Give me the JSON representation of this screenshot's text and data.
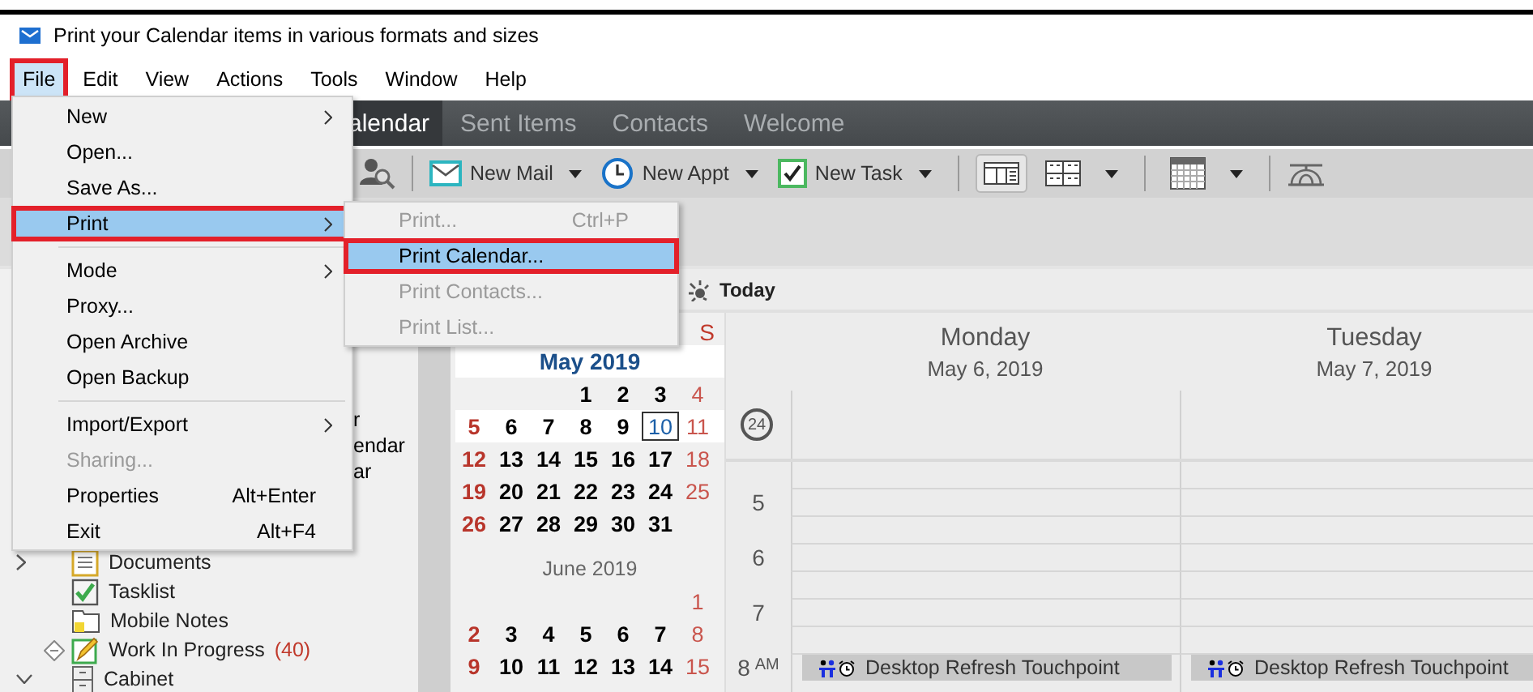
{
  "window": {
    "title": "Print your Calendar items in various formats and sizes"
  },
  "menu_bar": [
    {
      "label": "File",
      "selected": true,
      "callout": true
    },
    {
      "label": "Edit",
      "selected": false,
      "callout": false
    },
    {
      "label": "View",
      "selected": false,
      "callout": false
    },
    {
      "label": "Actions",
      "selected": false,
      "callout": false
    },
    {
      "label": "Tools",
      "selected": false,
      "callout": false
    },
    {
      "label": "Window",
      "selected": false,
      "callout": false
    },
    {
      "label": "Help",
      "selected": false,
      "callout": false
    }
  ],
  "file_menu": [
    {
      "kind": "item",
      "label": "New",
      "submenu": true,
      "disabled": false,
      "selected": false,
      "callout": false
    },
    {
      "kind": "item",
      "label": "Open...",
      "submenu": false,
      "disabled": false,
      "selected": false,
      "callout": false
    },
    {
      "kind": "item",
      "label": "Save As...",
      "submenu": false,
      "disabled": false,
      "selected": false,
      "callout": false
    },
    {
      "kind": "item",
      "label": "Print",
      "submenu": true,
      "disabled": false,
      "selected": true,
      "callout": true
    },
    {
      "kind": "separator"
    },
    {
      "kind": "item",
      "label": "Mode",
      "submenu": true,
      "disabled": false,
      "selected": false,
      "callout": false
    },
    {
      "kind": "item",
      "label": "Proxy...",
      "submenu": false,
      "disabled": false,
      "selected": false,
      "callout": false
    },
    {
      "kind": "item",
      "label": "Open Archive",
      "submenu": false,
      "disabled": false,
      "selected": false,
      "callout": false
    },
    {
      "kind": "item",
      "label": "Open Backup",
      "submenu": false,
      "disabled": false,
      "selected": false,
      "callout": false
    },
    {
      "kind": "separator"
    },
    {
      "kind": "item",
      "label": "Import/Export",
      "submenu": true,
      "disabled": false,
      "selected": false,
      "callout": false
    },
    {
      "kind": "item",
      "label": "Sharing...",
      "submenu": false,
      "disabled": true,
      "selected": false,
      "callout": false
    },
    {
      "kind": "item",
      "label": "Properties",
      "shortcut": "Alt+Enter",
      "submenu": false,
      "disabled": false,
      "selected": false,
      "callout": false
    },
    {
      "kind": "item",
      "label": "Exit",
      "shortcut": "Alt+F4",
      "submenu": false,
      "disabled": false,
      "selected": false,
      "callout": false
    }
  ],
  "print_submenu": [
    {
      "label": "Print...",
      "shortcut": "Ctrl+P",
      "disabled": true,
      "selected": false,
      "callout": false
    },
    {
      "label": "Print Calendar...",
      "disabled": false,
      "selected": true,
      "callout": true
    },
    {
      "label": "Print Contacts...",
      "disabled": true,
      "selected": false,
      "callout": false
    },
    {
      "label": "Print List...",
      "disabled": true,
      "selected": false,
      "callout": false
    }
  ],
  "app_tabs": [
    {
      "label": "alendar",
      "selected": true
    },
    {
      "label": "Sent Items",
      "selected": false
    },
    {
      "label": "Contacts",
      "selected": false
    },
    {
      "label": "Welcome",
      "selected": false
    }
  ],
  "toolbar": {
    "new_buttons": [
      {
        "kind": "mail",
        "label": "New Mail"
      },
      {
        "kind": "appt",
        "label": "New Appt"
      },
      {
        "kind": "task",
        "label": "New Task"
      }
    ],
    "view_buttons": [
      {
        "kind": "day",
        "selected": true
      },
      {
        "kind": "week",
        "selected": false
      },
      {
        "kind": "month",
        "selected": false
      }
    ]
  },
  "sidebar": {
    "partial_items": [
      "r",
      "endar",
      "ar"
    ],
    "folders": [
      {
        "kind": "documents",
        "label": "Documents",
        "expanded": false,
        "flagged": false
      },
      {
        "kind": "tasklist",
        "label": "Tasklist",
        "flagged": false
      },
      {
        "kind": "notes",
        "label": "Mobile Notes",
        "flagged": false
      },
      {
        "kind": "work",
        "label": "Work In Progress",
        "count": "(40)",
        "flagged": true
      },
      {
        "kind": "cabinet",
        "label": "Cabinet",
        "expanded": true,
        "flagged": false
      }
    ]
  },
  "today_button": {
    "label": "Today"
  },
  "mini_calendar": {
    "weekday_headers": [
      "S"
    ],
    "months": [
      {
        "title": "May 2019",
        "weeks": [
          {
            "selected": false,
            "days": [
              {
                "kind": "blank"
              },
              {
                "kind": "blank"
              },
              {
                "kind": "blank"
              },
              {
                "d": "1",
                "today": false
              },
              {
                "d": "2",
                "today": false
              },
              {
                "d": "3",
                "today": false
              },
              {
                "d": "4",
                "today": false
              }
            ]
          },
          {
            "selected": true,
            "days": [
              {
                "d": "5",
                "today": false
              },
              {
                "d": "6",
                "today": false
              },
              {
                "d": "7",
                "today": false
              },
              {
                "d": "8",
                "today": false
              },
              {
                "d": "9",
                "today": false
              },
              {
                "d": "10",
                "today": true
              },
              {
                "d": "11",
                "today": false
              }
            ]
          },
          {
            "selected": false,
            "days": [
              {
                "d": "12",
                "today": false
              },
              {
                "d": "13",
                "today": false
              },
              {
                "d": "14",
                "today": false
              },
              {
                "d": "15",
                "today": false
              },
              {
                "d": "16",
                "today": false
              },
              {
                "d": "17",
                "today": false
              },
              {
                "d": "18",
                "today": false
              }
            ]
          },
          {
            "selected": false,
            "days": [
              {
                "d": "19",
                "today": false
              },
              {
                "d": "20",
                "today": false
              },
              {
                "d": "21",
                "today": false
              },
              {
                "d": "22",
                "today": false
              },
              {
                "d": "23",
                "today": false
              },
              {
                "d": "24",
                "today": false
              },
              {
                "d": "25",
                "today": false
              }
            ]
          },
          {
            "selected": false,
            "days": [
              {
                "d": "26",
                "today": false
              },
              {
                "d": "27",
                "today": false
              },
              {
                "d": "28",
                "today": false
              },
              {
                "d": "29",
                "today": false
              },
              {
                "d": "30",
                "today": false
              },
              {
                "d": "31",
                "today": false
              },
              {
                "kind": "blank"
              }
            ]
          }
        ]
      },
      {
        "title": "June 2019",
        "weeks": [
          {
            "selected": false,
            "days": [
              {
                "kind": "blank"
              },
              {
                "kind": "blank"
              },
              {
                "kind": "blank"
              },
              {
                "kind": "blank"
              },
              {
                "kind": "blank"
              },
              {
                "kind": "blank"
              },
              {
                "d": "1",
                "today": false
              }
            ]
          },
          {
            "selected": false,
            "days": [
              {
                "d": "2",
                "today": false
              },
              {
                "d": "3",
                "today": false
              },
              {
                "d": "4",
                "today": false
              },
              {
                "d": "5",
                "today": false
              },
              {
                "d": "6",
                "today": false
              },
              {
                "d": "7",
                "today": false
              },
              {
                "d": "8",
                "today": false
              }
            ]
          },
          {
            "selected": false,
            "days": [
              {
                "d": "9",
                "today": false
              },
              {
                "d": "10",
                "today": false
              },
              {
                "d": "11",
                "today": false
              },
              {
                "d": "12",
                "today": false
              },
              {
                "d": "13",
                "today": false
              },
              {
                "d": "14",
                "today": false
              },
              {
                "d": "15",
                "today": false
              }
            ]
          }
        ]
      }
    ]
  },
  "day_view": {
    "all_day_badge": "24",
    "hours": [
      {
        "label": "5"
      },
      {
        "label": "6"
      },
      {
        "label": "7"
      },
      {
        "label": "8",
        "suffix": "AM"
      }
    ],
    "days": [
      {
        "weekday": "Monday",
        "date": "May 6, 2019",
        "events": [
          {
            "kind": "meeting",
            "title": "Desktop Refresh Touchpoint"
          }
        ]
      },
      {
        "weekday": "Tuesday",
        "date": "May 7, 2019",
        "events": [
          {
            "kind": "meeting",
            "title": "Desktop Refresh Touchpoint"
          }
        ]
      }
    ]
  }
}
